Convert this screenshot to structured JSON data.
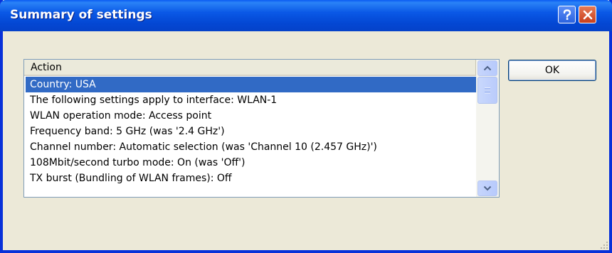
{
  "window": {
    "title": "Summary of settings",
    "help_glyph": "?",
    "close_glyph": "X"
  },
  "list": {
    "column_header": "Action",
    "rows": [
      "Country: USA",
      "The following settings apply to interface: WLAN-1",
      "WLAN operation mode: Access point",
      "Frequency band: 5 GHz (was '2.4 GHz')",
      "Channel number: Automatic selection (was 'Channel 10 (2.457 GHz)')",
      "108Mbit/second turbo mode: On (was 'Off')",
      "TX burst (Bundling of WLAN frames): Off"
    ],
    "selected_index": 0
  },
  "buttons": {
    "ok_label": "OK"
  },
  "colors": {
    "titlebar": "#0a58e6",
    "selection": "#316ac5",
    "dialog_bg": "#ece9d8"
  }
}
